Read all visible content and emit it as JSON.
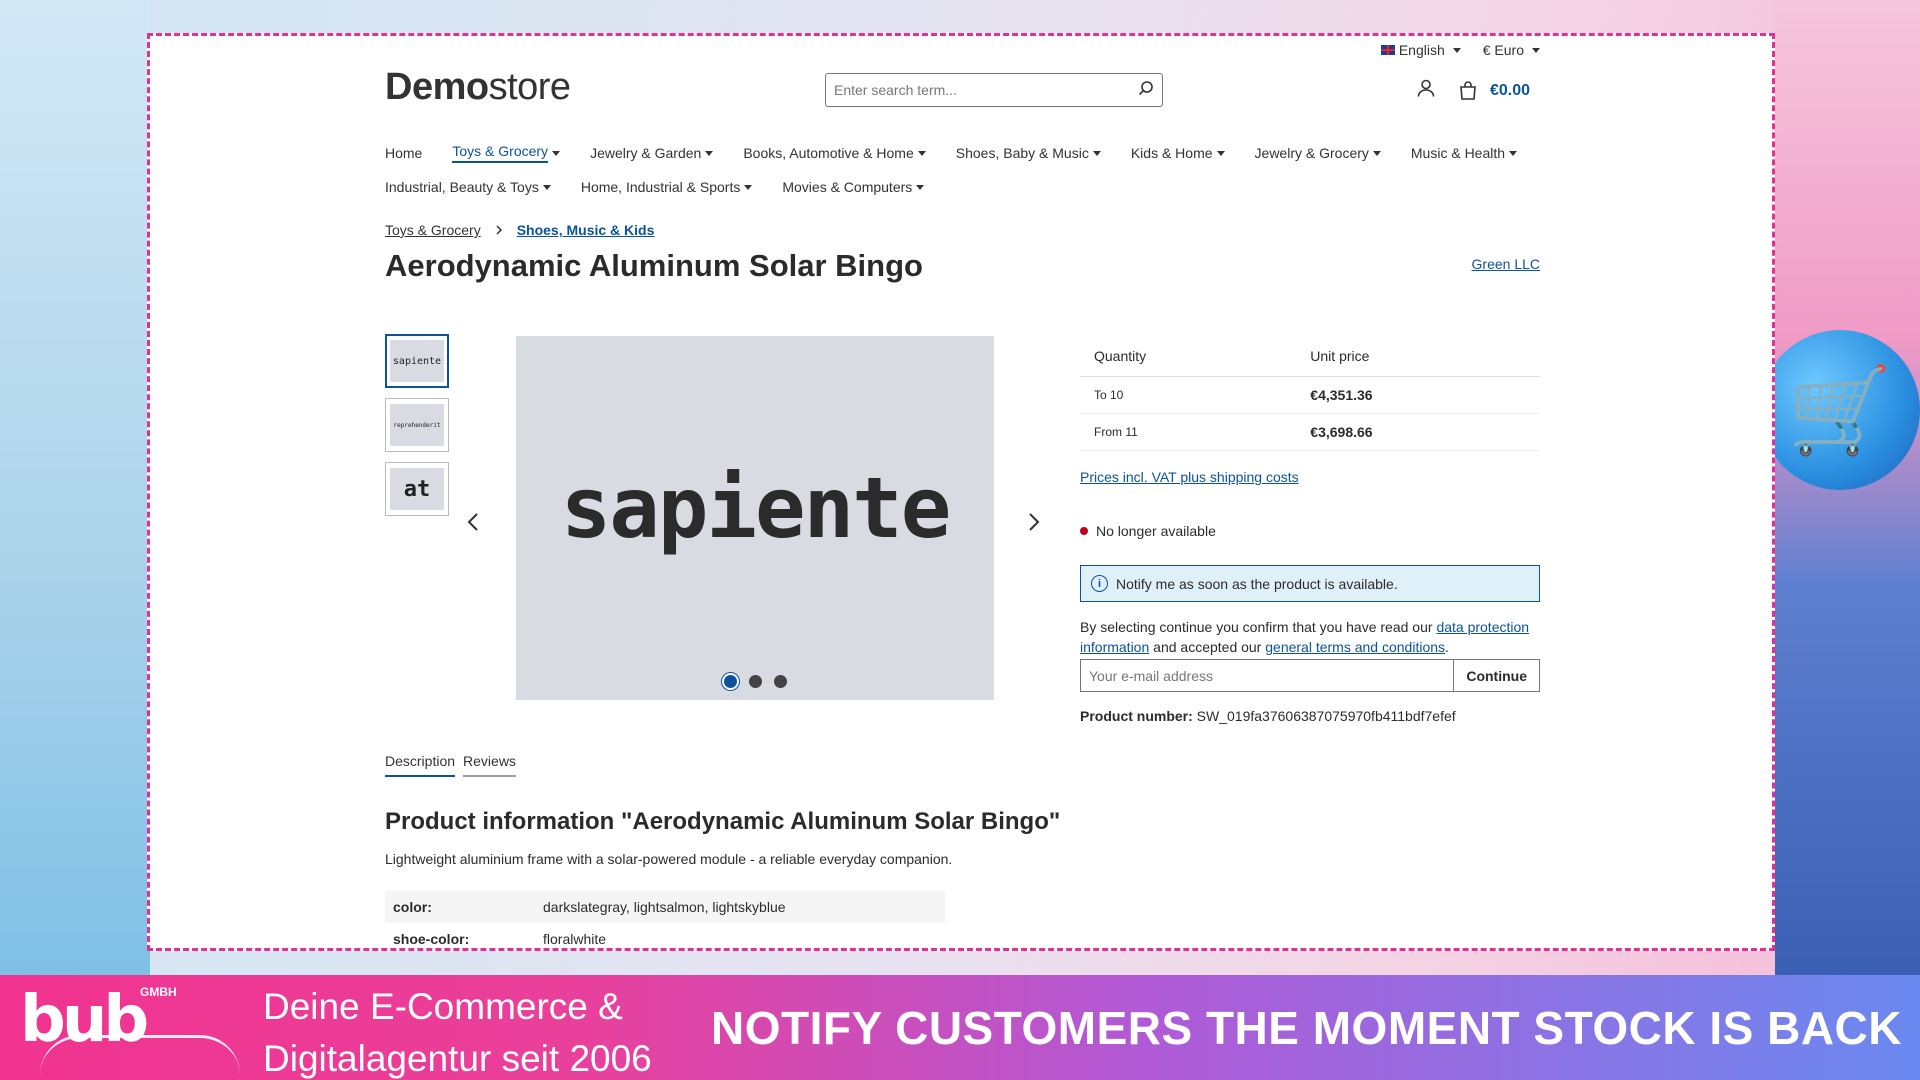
{
  "topbar": {
    "language": "English",
    "currency": "€ Euro"
  },
  "logo": {
    "bold": "Demo",
    "light": "store"
  },
  "search": {
    "placeholder": "Enter search term..."
  },
  "cart": {
    "total": "€0.00"
  },
  "nav": {
    "row1": [
      "Home",
      "Toys & Grocery",
      "Jewelry & Garden",
      "Books, Automotive & Home",
      "Shoes, Baby & Music",
      "Kids & Home",
      "Jewelry & Grocery",
      "Music & Health"
    ],
    "row2": [
      "Industrial, Beauty & Toys",
      "Home, Industrial & Sports",
      "Movies & Computers"
    ]
  },
  "breadcrumb": {
    "first": "Toys & Grocery",
    "current": "Shoes, Music & Kids"
  },
  "product": {
    "title": "Aerodynamic Aluminum Solar Bingo",
    "manufacturer": "Green LLC",
    "images": [
      "sapiente",
      "reprehenderit",
      "at"
    ],
    "main_image_text": "sapiente"
  },
  "pricing": {
    "col_quantity": "Quantity",
    "col_price": "Unit price",
    "rows": [
      {
        "qty": "To 10",
        "price": "€4,351.36"
      },
      {
        "qty": "From 11",
        "price": "€3,698.66"
      }
    ],
    "vat_link": "Prices incl. VAT plus shipping costs"
  },
  "availability": {
    "status": "No longer available",
    "status_color": "#c0001a"
  },
  "notify": {
    "message": "Notify me as soon as the product is available.",
    "consent_pre": "By selecting continue you confirm that you have read our ",
    "consent_link1": "data protection information",
    "consent_mid": " and accepted our ",
    "consent_link2": "general terms and conditions",
    "consent_end": ".",
    "email_placeholder": "Your e-mail address",
    "button": "Continue"
  },
  "product_number": {
    "label": "Product number:",
    "value": "SW_019fa37606387075970fb411bdf7efef"
  },
  "tabs": [
    "Description",
    "Reviews"
  ],
  "description": {
    "heading": "Product information \"Aerodynamic Aluminum Solar Bingo\"",
    "text": "Lightweight aluminium frame with a solar-powered module - a reliable everyday companion.",
    "properties": [
      {
        "key": "color:",
        "value": "darkslategray, lightsalmon, lightskyblue"
      },
      {
        "key": "shoe-color:",
        "value": "floralwhite"
      }
    ]
  },
  "footer": {
    "brand": "bub",
    "brand_suffix": "GMBH",
    "tagline_line1": "Deine E-Commerce &",
    "tagline_line2": "Digitalagentur seit 2006",
    "slogan": "NOTIFY CUSTOMERS THE MOMENT STOCK IS BACK"
  },
  "colors": {
    "accent": "#0b539b",
    "frame": "#e0309a",
    "footer_start": "#f0338f",
    "footer_end": "#6a89f0"
  }
}
